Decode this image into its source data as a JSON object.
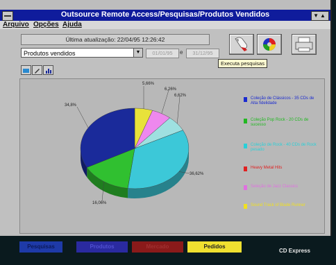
{
  "window": {
    "title": "Outsource Remote Access/Pesquisas/Produtos Vendidos"
  },
  "menu": {
    "items": [
      "Arquivo",
      "Opções",
      "Ajuda"
    ]
  },
  "header": {
    "last_update": "Última atualização: 22/04/95 12:26:42",
    "report_select": "Produtos vendidos",
    "date_from": "01/01/95",
    "date_connector": "e",
    "date_to": "31/12/95"
  },
  "toolbar": {
    "execute_tooltip": "Executa pesquisas",
    "icons": [
      "execute-search-icon",
      "color-palette-icon",
      "printer-icon"
    ],
    "small_icons": [
      "view-icon",
      "edit-icon",
      "chart-icon"
    ]
  },
  "chart_data": {
    "type": "pie",
    "values": [
      5.66,
      6.26,
      6.62,
      36.62,
      16.06,
      34.8
    ],
    "labels": [
      "5,66%",
      "6,26%",
      "6,62%",
      "36,62%",
      "16,06%",
      "34,8%"
    ],
    "colors": [
      "#e8e23a",
      "#ee88ee",
      "#9ee0e0",
      "#3cc8d8",
      "#30c030",
      "#1a2a9a"
    ]
  },
  "legend": [
    {
      "label": "Coleção de Clássicos - 35 CDs de Alta fidelidade",
      "color": "#1a2ad0"
    },
    {
      "label": "Coleção Pop Rock - 20 CDs de sucesso",
      "color": "#22b822"
    },
    {
      "label": "Coleção de Rock - 40 CDs de Rock pesado",
      "color": "#2ad0d8"
    },
    {
      "label": "Heavy Metal Hits",
      "color": "#e02020"
    },
    {
      "label": "Seleção de Jazz Classics",
      "color": "#e070e0"
    },
    {
      "label": "Sound Track of Blade Runner",
      "color": "#f0e020"
    }
  ],
  "tabs": [
    {
      "label": "Pesquisas",
      "bg": "#1e3aa8",
      "fg": "#0c1a5a"
    },
    {
      "label": "Produtos",
      "bg": "#2a2aa0",
      "fg": "#5050d0"
    },
    {
      "label": "Mercado",
      "bg": "#8a1a1a",
      "fg": "#a03030"
    },
    {
      "label": "Pedidos",
      "bg": "#f0e030",
      "fg": "#222222"
    }
  ],
  "brand": "CD Express"
}
